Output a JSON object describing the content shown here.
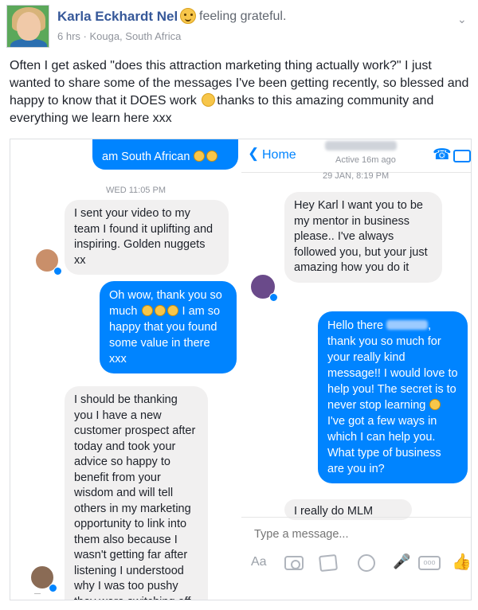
{
  "post": {
    "author": "Karla Eckhardt Nel",
    "feeling": "feeling grateful.",
    "meta": "6 hrs · Kouga, South Africa",
    "menu_icon": "chevron-down-icon",
    "text_part1": "Often I get asked \"does this attraction marketing thing actually work?\" I just wanted to share some of the messages I've been getting recently, so blessed and happy to know that it DOES work ",
    "text_part2": "thanks to this amazing community and everything we learn here xxx"
  },
  "left_chat": {
    "top_partial": "am South African",
    "date": "WED 11:05 PM",
    "msg_incoming_1": "I sent your video to my team I found it uplifting and inspiring. Golden nuggets xx",
    "msg_outgoing_1a": "Oh wow, thank you so much",
    "msg_outgoing_1b": "I am so happy that you found some value in there xxx",
    "msg_incoming_2": "I should be thanking you I have a new customer prospect after today and took your advice so happy to benefit from your wisdom and will tell others in my marketing opportunity to link into them also because I wasn't getting far after listening I understood why I was too pushy they were switching off"
  },
  "right_chat": {
    "back_label": "Home",
    "active_status": "Active 16m ago",
    "date": "29 JAN, 8:19 PM",
    "msg_incoming_1": "Hey Karl  I want you to be my mentor  in business please.. I've always followed you, but your just amazing  how you do it",
    "msg_outgoing_1a": "Hello there ",
    "msg_outgoing_1b": ", thank you so much for your really kind message!! I would love to help you! The secret is to never stop learning ",
    "msg_outgoing_1c": "I've got a few ways in which I can help you. What type of business are you in?",
    "msg_incoming_partial": "I really  do MLM",
    "input_placeholder": "Type a message...",
    "toolbar": {
      "aa_label": "Aa",
      "more_label": "ooo"
    }
  },
  "colors": {
    "messenger_blue": "#0084ff",
    "facebook_link": "#365899",
    "bubble_gray": "#f1f0f0"
  }
}
